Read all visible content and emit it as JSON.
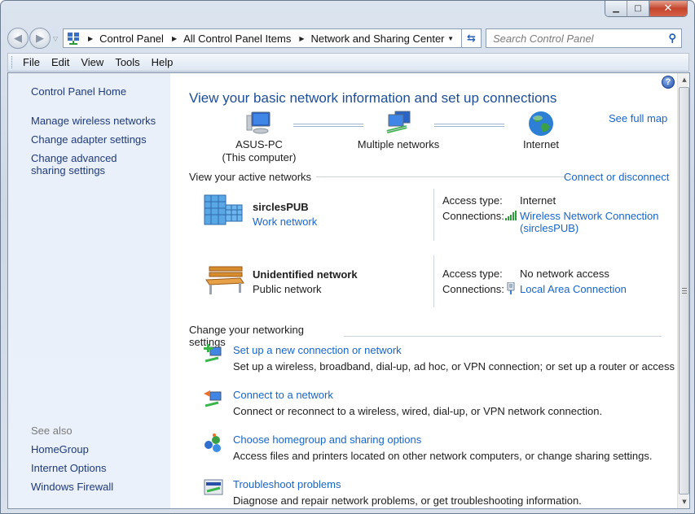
{
  "window": {
    "minimize": "minimize",
    "maximize": "maximize",
    "close": "close"
  },
  "nav": {
    "back_icon": "back-arrow-icon",
    "forward_icon": "forward-arrow-icon",
    "breadcrumb": [
      "Control Panel",
      "All Control Panel Items",
      "Network and Sharing Center"
    ],
    "search_placeholder": "Search Control Panel"
  },
  "menu": [
    "File",
    "Edit",
    "View",
    "Tools",
    "Help"
  ],
  "sidebar": {
    "items": [
      "Control Panel Home",
      "Manage wireless networks",
      "Change adapter settings",
      "Change advanced sharing settings"
    ],
    "see_also_label": "See also",
    "see_also": [
      "HomeGroup",
      "Internet Options",
      "Windows Firewall"
    ]
  },
  "main": {
    "title": "View your basic network information and set up connections",
    "see_full_map": "See full map",
    "map": [
      {
        "label": "ASUS-PC",
        "sub": "(This computer)",
        "icon": "computer-icon"
      },
      {
        "label": "Multiple networks",
        "sub": "",
        "icon": "multiple-networks-icon"
      },
      {
        "label": "Internet",
        "sub": "",
        "icon": "globe-icon"
      }
    ],
    "active_header": "View your active networks",
    "connect_disconnect": "Connect or disconnect",
    "networks": [
      {
        "name": "sirclesPUB",
        "type": "Work network",
        "type_is_link": true,
        "access_label": "Access type:",
        "access": "Internet",
        "conn_label": "Connections:",
        "conn_icon": "wifi-signal-icon",
        "connection": "Wireless Network Connection",
        "connection2": "(sirclesPUB)"
      },
      {
        "name": "Unidentified network",
        "type": "Public network",
        "type_is_link": false,
        "access_label": "Access type:",
        "access": "No network access",
        "conn_label": "Connections:",
        "conn_icon": "ethernet-plug-icon",
        "connection": "Local Area Connection",
        "connection2": ""
      }
    ],
    "change_header": "Change your networking settings",
    "tasks": [
      {
        "title": "Set up a new connection or network",
        "desc": "Set up a wireless, broadband, dial-up, ad hoc, or VPN connection; or set up a router or access point.",
        "icon": "new-connection-icon"
      },
      {
        "title": "Connect to a network",
        "desc": "Connect or reconnect to a wireless, wired, dial-up, or VPN network connection.",
        "icon": "connect-network-icon"
      },
      {
        "title": "Choose homegroup and sharing options",
        "desc": "Access files and printers located on other network computers, or change sharing settings.",
        "icon": "homegroup-icon"
      },
      {
        "title": "Troubleshoot problems",
        "desc": "Diagnose and repair network problems, or get troubleshooting information.",
        "icon": "troubleshoot-icon"
      }
    ]
  },
  "colors": {
    "link": "#1865c8",
    "sidebar_link": "#1f3a78",
    "title": "#1e4d94"
  }
}
